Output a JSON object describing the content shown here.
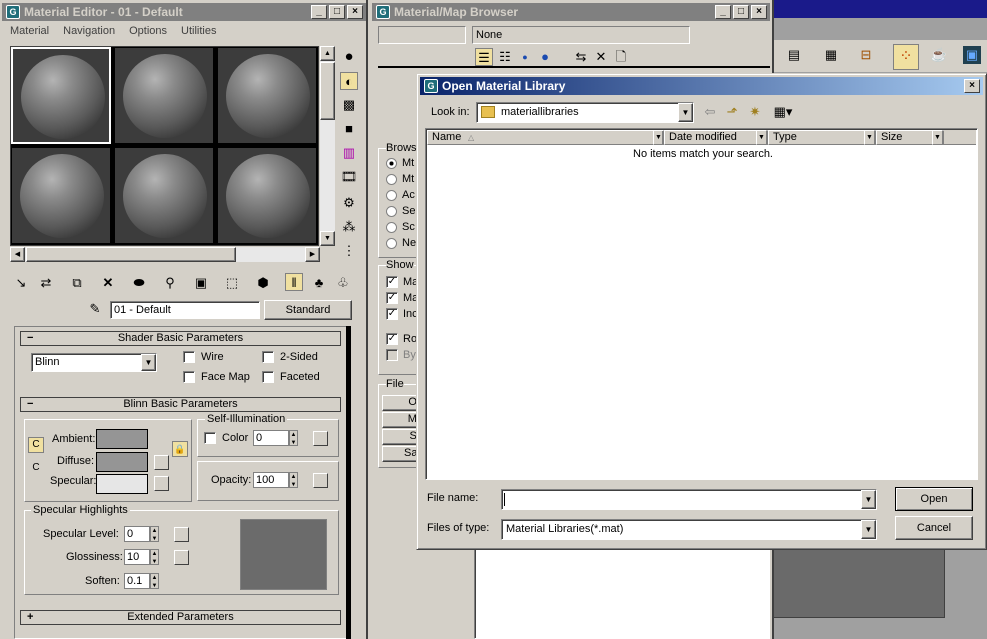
{
  "matEditor": {
    "title": "Material Editor - 01 - Default",
    "menu": [
      "Material",
      "Navigation",
      "Options",
      "Utilities"
    ],
    "materialName": "01 - Default",
    "materialType": "Standard",
    "shaderRollout": "Shader Basic Parameters",
    "shader": "Blinn",
    "wire": "Wire",
    "twoSided": "2-Sided",
    "faceMap": "Face Map",
    "faceted": "Faceted",
    "blinnRollout": "Blinn Basic Parameters",
    "selfIllum": "Self-Illumination",
    "ambient": "Ambient:",
    "diffuse": "Diffuse:",
    "specular": "Specular:",
    "colorLabel": "Color",
    "colorVal": "0",
    "opacity": "Opacity:",
    "opacityVal": "100",
    "specHighlights": "Specular Highlights",
    "specLevel": "Specular Level:",
    "specLevelVal": "0",
    "glossiness": "Glossiness:",
    "glossVal": "10",
    "soften": "Soften:",
    "softenVal": "0.1",
    "extended": "Extended Parameters",
    "collapseSign": "−",
    "expandSign": "+"
  },
  "browser": {
    "title": "Material/Map Browser",
    "none": "None",
    "browse": "Brows",
    "radios": [
      "Mt",
      "Mt",
      "Ac",
      "Se",
      "Sc",
      "Ne"
    ],
    "show": "Show",
    "showItems": [
      "Ma",
      "Ma",
      "Inc"
    ],
    "root": "Ro",
    "by": "By",
    "file": "File",
    "fileBtns": [
      "Op",
      "Me",
      "Sa",
      "Sav"
    ]
  },
  "dialog": {
    "title": "Open Material Library",
    "lookIn": "Look in:",
    "folder": "materiallibraries",
    "columns": [
      "Name",
      "Date modified",
      "Type",
      "Size"
    ],
    "empty": "No items match your search.",
    "fileName": "File name:",
    "fileNameVal": "",
    "filesOfType": "Files of type:",
    "typeVal": "Material Libraries(*.mat)",
    "open": "Open",
    "cancel": "Cancel"
  },
  "glyphs": {
    "minimize": "_",
    "maximize": "□",
    "close": "×",
    "dropdown": "▼",
    "up": "▲",
    "down": "▼",
    "left": "◀",
    "right": "▶",
    "back": "⇦",
    "lock": "🔒",
    "sortUp": "△"
  }
}
